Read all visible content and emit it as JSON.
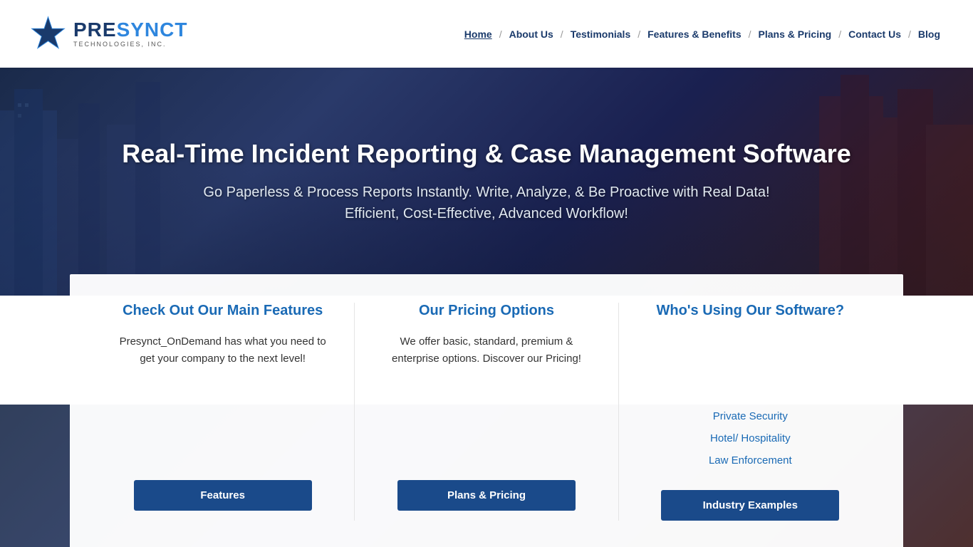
{
  "header": {
    "logo": {
      "pre": "PRE",
      "synct": "SYNCT",
      "sub": "TECHNOLOGIES, INC."
    },
    "nav": [
      {
        "label": "Home",
        "active": true
      },
      {
        "label": "About Us",
        "active": false
      },
      {
        "label": "Testimonials",
        "active": false
      },
      {
        "label": "Features & Benefits",
        "active": false
      },
      {
        "label": "Plans & Pricing",
        "active": false
      },
      {
        "label": "Contact Us",
        "active": false
      },
      {
        "label": "Blog",
        "active": false
      }
    ]
  },
  "hero": {
    "title": "Real-Time Incident Reporting & Case Management Software",
    "subtitle_line1": "Go Paperless & Process Reports Instantly. Write, Analyze, & Be Proactive with Real Data!",
    "subtitle_line2": "Efficient, Cost-Effective, Advanced Workflow!"
  },
  "cards": [
    {
      "id": "features-card",
      "title": "Check Out Our Main Features",
      "body": "Presynct_OnDemand has what you need to get your company to the next level!",
      "links": [],
      "button_label": "Features"
    },
    {
      "id": "pricing-card",
      "title": "Our Pricing Options",
      "body": "We offer basic, standard, premium & enterprise options. Discover our Pricing!",
      "links": [],
      "button_label": "Plans & Pricing"
    },
    {
      "id": "industry-card",
      "title": "Who's Using Our Software?",
      "body": "",
      "links": [
        {
          "label": "Private Security"
        },
        {
          "label": "Hotel/ Hospitality"
        },
        {
          "label": "Law Enforcement"
        }
      ],
      "button_label": "Industry Examples"
    }
  ]
}
